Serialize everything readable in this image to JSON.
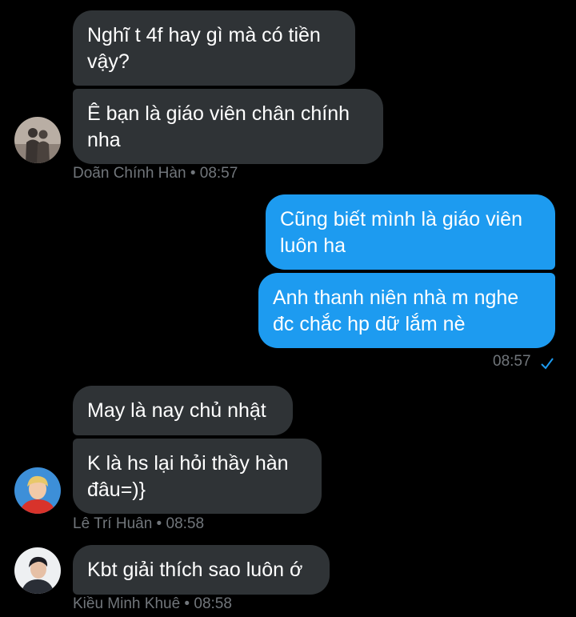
{
  "colors": {
    "background": "#000000",
    "incoming_bubble": "#2f3336",
    "outgoing_bubble": "#1d9bf0",
    "meta_text": "#71767b",
    "read_check": "#1d9bf0"
  },
  "groups": [
    {
      "sender": "Doãn Chính Hàn",
      "time": "08:57",
      "avatar_icon": "couple-silhouette-avatar-icon",
      "messages": [
        "Nghĩ t 4f hay gì mà có tiền vậy?",
        "Ê bạn là giáo viên chân chính nha"
      ]
    },
    {
      "sender": "me",
      "time": "08:57",
      "status_icon": "read-check-icon",
      "messages": [
        "Cũng biết mình là giáo viên luôn ha",
        "Anh thanh niên nhà m nghe đc chắc hp dữ lắm nè"
      ]
    },
    {
      "sender": "Lê Trí Huân",
      "time": "08:58",
      "avatar_icon": "person-red-shirt-avatar-icon",
      "messages": [
        "May là nay chủ nhật",
        "K là hs lại hỏi thầy hàn đâu=)}"
      ]
    },
    {
      "sender": "Kiều Minh Khuê",
      "time": "08:58",
      "avatar_icon": "person-portrait-avatar-icon",
      "messages": [
        "Kbt giải thích sao luôn ớ"
      ]
    }
  ],
  "separator": " • "
}
